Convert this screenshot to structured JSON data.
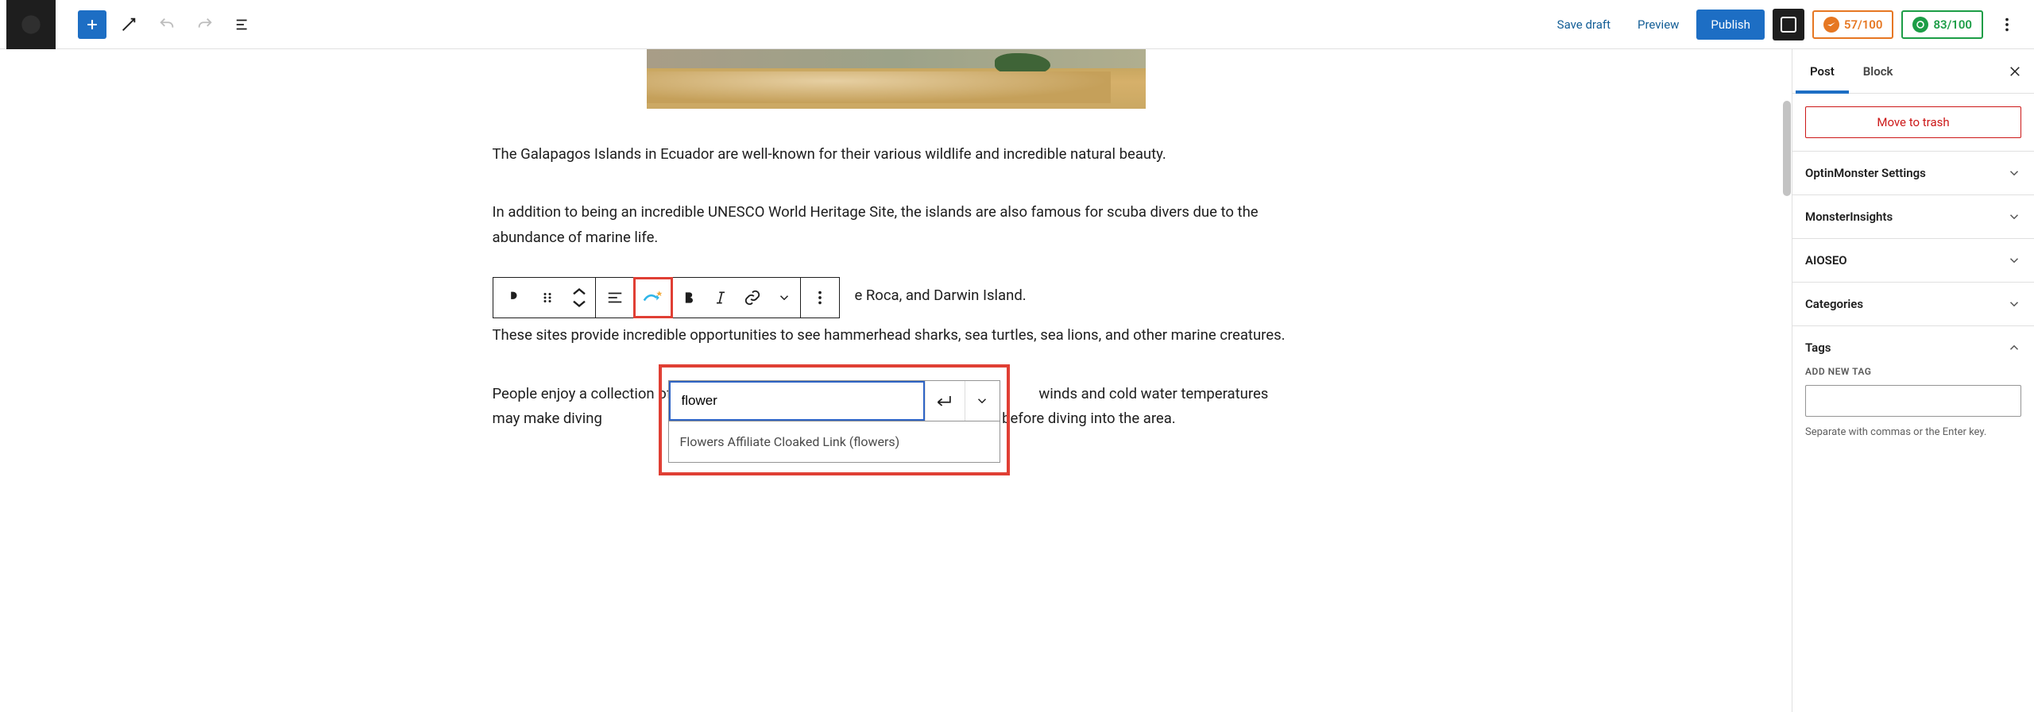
{
  "topbar": {
    "save_draft": "Save draft",
    "preview": "Preview",
    "publish": "Publish",
    "score1": "57/100",
    "score2": "83/100"
  },
  "editor": {
    "para1": "The Galapagos Islands in Ecuador are well-known for their various wildlife and incredible natural beauty.",
    "para2": "In addition to being an incredible UNESCO World Heritage Site, the islands are also famous for scuba divers due to the abundance of marine life.",
    "para3_visible": "e Roca, and Darwin Island.",
    "para4": "These sites provide incredible opportunities to see hammerhead sharks, sea turtles, sea lions, and other marine creatures.",
    "para5": "People enjoy a collection of ma                                                                                              winds and cold water temperatures may make diving                                                                          training is essential before diving into the area."
  },
  "link_popup": {
    "input_value": "flower",
    "suggestion": "Flowers Affiliate Cloaked Link (flowers)"
  },
  "sidebar": {
    "tabs": {
      "post": "Post",
      "block": "Block"
    },
    "trash": "Move to trash",
    "panels": {
      "optinmonster": "OptinMonster Settings",
      "monsterinsights": "MonsterInsights",
      "aioseo": "AIOSEO",
      "categories": "Categories",
      "tags": "Tags"
    },
    "tags": {
      "add_label": "ADD NEW TAG",
      "hint": "Separate with commas or the Enter key."
    }
  }
}
